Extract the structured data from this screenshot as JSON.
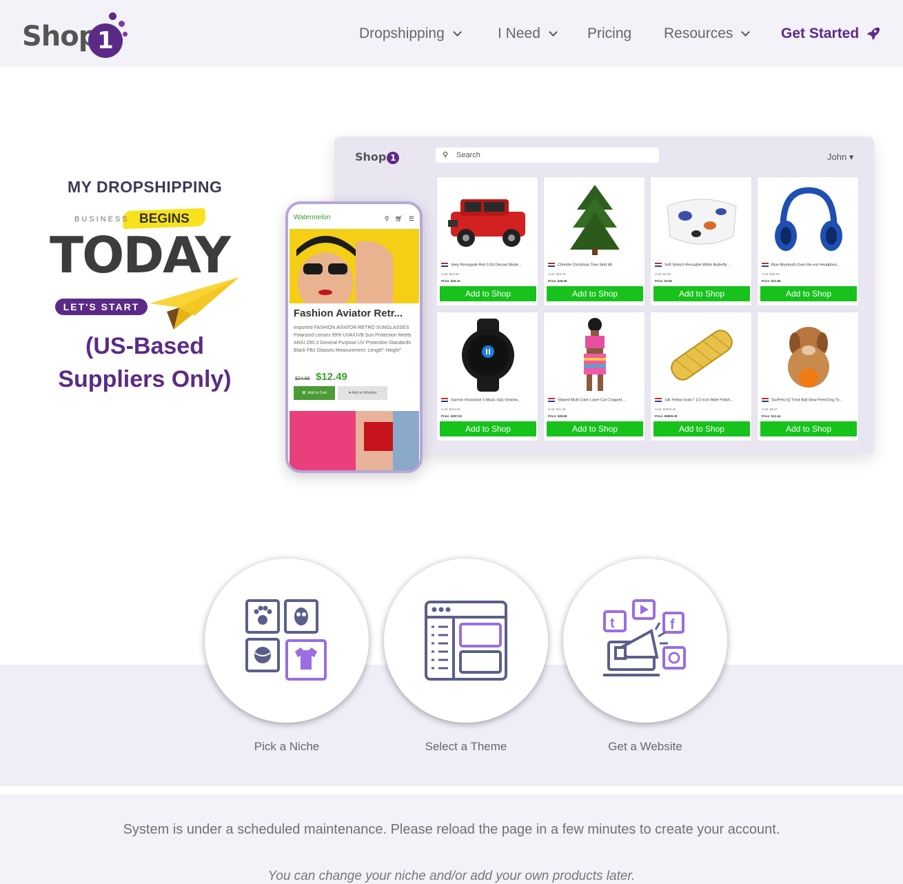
{
  "brand": {
    "logo_text": "Shop",
    "logo_digit": "1"
  },
  "nav": {
    "items": [
      {
        "label": "Dropshipping",
        "has_dropdown": true
      },
      {
        "label": "I Need",
        "has_dropdown": true
      },
      {
        "label": "Pricing",
        "has_dropdown": false
      },
      {
        "label": "Resources",
        "has_dropdown": true
      }
    ],
    "cta": "Get Started",
    "cta_icon": "rocket-icon"
  },
  "hero": {
    "line1": "MY DROPSHIPPING",
    "business": "BUSINESS",
    "begins": "BEGINS",
    "today": "TODAY",
    "lets_start": "LET'S START",
    "suppliers_line1": "(US-Based",
    "suppliers_line2": "Suppliers Only)"
  },
  "dashboard": {
    "logo_text": "Shop",
    "logo_digit": "1",
    "search_placeholder": "Search",
    "user": "John",
    "products": [
      {
        "title": "Jeep Renegade Red 1/24 Diecast Mode...",
        "cost": "Cost: $21.59",
        "price": "Price: $29.15",
        "button": "Add to Shop"
      },
      {
        "title": "Chenille Christmas Tree Skirt 48",
        "cost": "Cost: $33.75",
        "price": "Price: $45.56",
        "button": "Add to Shop"
      },
      {
        "title": "Soft Stretch Reusable White Butterfly ...",
        "cost": "Cost: $1.93",
        "price": "Price: $2.60",
        "button": "Add to Shop"
      },
      {
        "title": "Blue Bluetooth Over-the-ear Headphon...",
        "cost": "Cost: $16.06",
        "price": "Price: $21.68",
        "button": "Add to Shop"
      },
      {
        "title": "Garmin Vivoactive 3 Music Gps Smartw...",
        "cost": "Cost: $212.62",
        "price": "Price: $287.03",
        "button": "Add to Shop"
      },
      {
        "title": "Striped Multi Color Laser Cut Cropped ...",
        "cost": "Cost: $21.38",
        "price": "Price: $28.86",
        "button": "Add to Shop"
      },
      {
        "title": "14k Yellow Gold 7 1/2 inch Wide Polish...",
        "cost": "Cost: $4003.25",
        "price": "Price: $5809.39",
        "button": "Add to Shop"
      },
      {
        "title": "OurPets IQ Treat Ball Slow Feed Dog To...",
        "cost": "Cost: $9.57",
        "price": "Price: $12.44",
        "button": "Add to Shop"
      }
    ]
  },
  "phone": {
    "store_name": "Watermelon",
    "product_name": "Fashion Aviator Retr...",
    "description": "Imported FASHION AVIATOR RETRO SUNGLASSES Polarized Lenses 99% UVA/UVB Sun Protection Meets ANSI Z80.3 General Purpose UV Protection Standards Black FBJ Glasses Measurement: Length\" Height\"",
    "old_price": "$24.98",
    "new_price": "$12.49",
    "add_to_cart": "Add to Cart",
    "add_to_wishlist": "Add to Wishlist"
  },
  "steps": [
    {
      "label": "Pick a Niche",
      "icon": "niche-grid-icon"
    },
    {
      "label": "Select a Theme",
      "icon": "theme-layout-icon"
    },
    {
      "label": "Get a Website",
      "icon": "website-megaphone-icon"
    }
  ],
  "maintenance_message": "System is under a scheduled maintenance. Please reload the page in a few minutes to create your account.",
  "footer_note": "You can change your niche and/or add your own products later.",
  "colors": {
    "brand_purple": "#5b2a86",
    "add_green": "#17c21c",
    "header_bg": "#f3f2f8",
    "highlight_yellow": "#f7e21c"
  }
}
